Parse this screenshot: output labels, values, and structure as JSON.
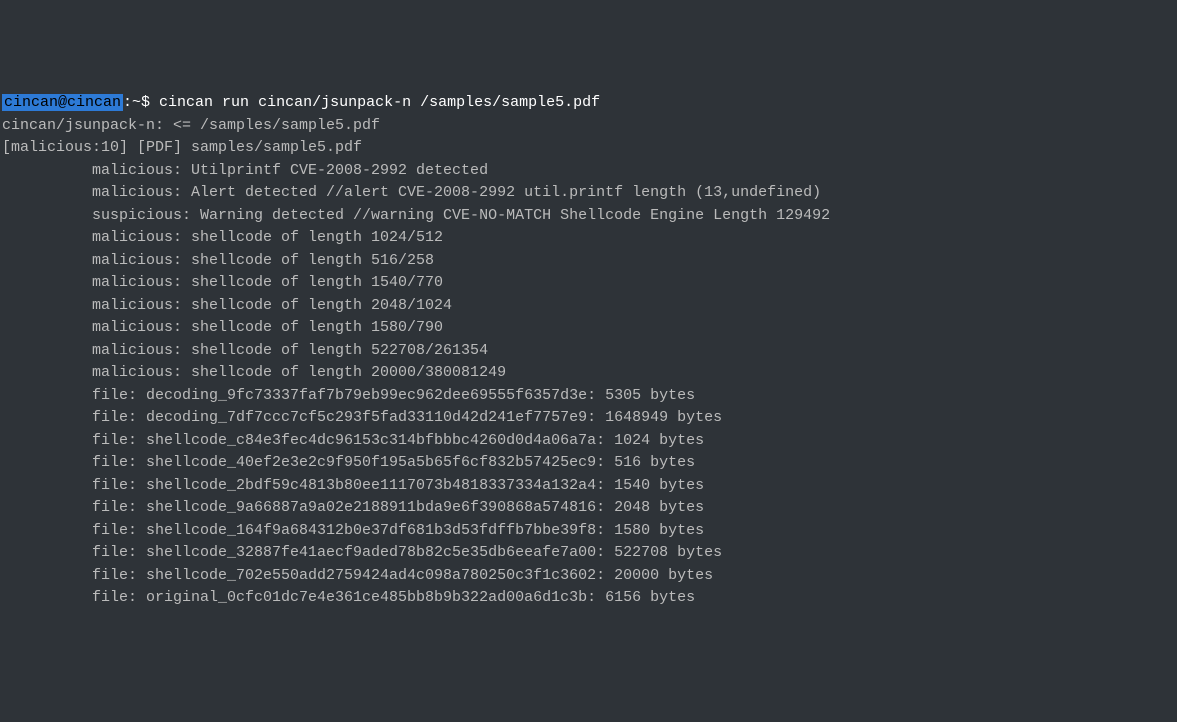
{
  "prompt": {
    "user_host": "cincan@cincan",
    "suffix": ":~$ ",
    "command": "cincan run cincan/jsunpack-n /samples/sample5.pdf"
  },
  "output": {
    "line1": "cincan/jsunpack-n: <= /samples/sample5.pdf",
    "line2": "[malicious:10] [PDF] samples/sample5.pdf",
    "indented": [
      "malicious: Utilprintf CVE-2008-2992 detected",
      "malicious: Alert detected //alert CVE-2008-2992 util.printf length (13,undefined)",
      "suspicious: Warning detected //warning CVE-NO-MATCH Shellcode Engine Length 129492",
      "malicious: shellcode of length 1024/512",
      "malicious: shellcode of length 516/258",
      "malicious: shellcode of length 1540/770",
      "malicious: shellcode of length 2048/1024",
      "malicious: shellcode of length 1580/790",
      "malicious: shellcode of length 522708/261354",
      "malicious: shellcode of length 20000/380081249",
      "file: decoding_9fc73337faf7b79eb99ec962dee69555f6357d3e: 5305 bytes",
      "file: decoding_7df7ccc7cf5c293f5fad33110d42d241ef7757e9: 1648949 bytes",
      "file: shellcode_c84e3fec4dc96153c314bfbbbc4260d0d4a06a7a: 1024 bytes",
      "file: shellcode_40ef2e3e2c9f950f195a5b65f6cf832b57425ec9: 516 bytes",
      "file: shellcode_2bdf59c4813b80ee1117073b4818337334a132a4: 1540 bytes",
      "file: shellcode_9a66887a9a02e2188911bda9e6f390868a574816: 2048 bytes",
      "file: shellcode_164f9a684312b0e37df681b3d53fdffb7bbe39f8: 1580 bytes",
      "file: shellcode_32887fe41aecf9aded78b82c5e35db6eeafe7a00: 522708 bytes",
      "file: shellcode_702e550add2759424ad4c098a780250c3f1c3602: 20000 bytes",
      "file: original_0cfc01dc7e4e361ce485bb8b9b322ad00a6d1c3b: 6156 bytes"
    ]
  }
}
